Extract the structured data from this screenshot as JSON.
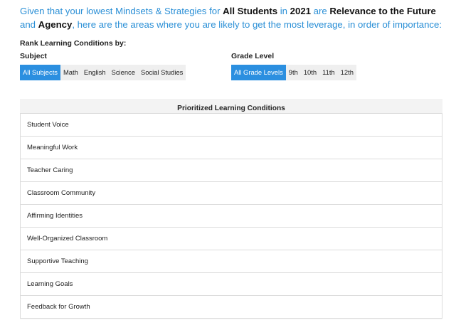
{
  "intro": {
    "p1": "Given that your lowest Mindsets & Strategies for ",
    "group": "All Students",
    "p2": " in ",
    "year": "2021",
    "p3": " are ",
    "area1": "Relevance to the Future",
    "p4": " and ",
    "area2": "Agency",
    "p5": ", here are the areas where you are likely to get the most leverage, in order of importance:"
  },
  "rank": {
    "title": "Rank Learning Conditions by:",
    "subject": {
      "label": "Subject",
      "options": [
        "All Subjects",
        "Math",
        "English",
        "Science",
        "Social Studies"
      ],
      "selected": "All Subjects"
    },
    "grade": {
      "label": "Grade Level",
      "options": [
        "All Grade Levels",
        "9th",
        "10th",
        "11th",
        "12th"
      ],
      "selected": "All Grade Levels"
    }
  },
  "panel": {
    "title": "Prioritized Learning Conditions",
    "items": [
      "Student Voice",
      "Meaningful Work",
      "Teacher Caring",
      "Classroom Community",
      "Affirming Identities",
      "Well-Organized Classroom",
      "Supportive Teaching",
      "Learning Goals",
      "Feedback for Growth"
    ]
  },
  "colors": {
    "accent": "#2b8fe0",
    "intro_text": "#2a8fd6",
    "segment_bg": "#efefef",
    "panel_bg": "#f3f3f3"
  }
}
